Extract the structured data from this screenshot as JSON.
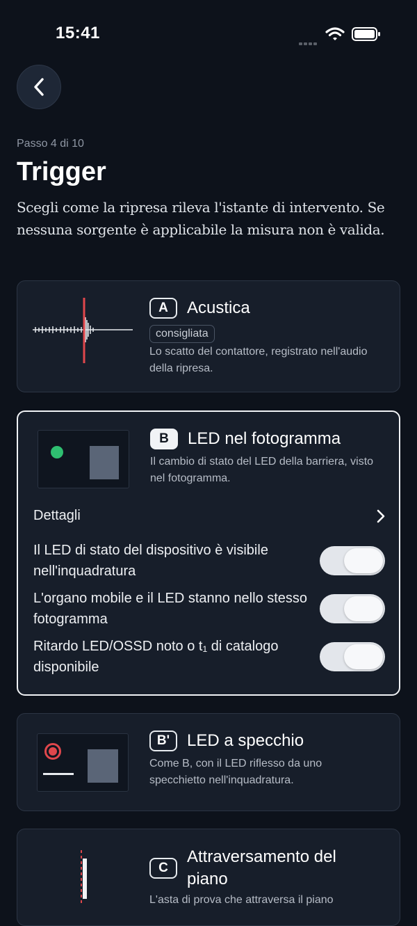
{
  "status_bar": {
    "time": "15:41"
  },
  "header": {
    "step": "Passo 4 di 10",
    "title": "Trigger",
    "subtitle": "Scegli come la ripresa rileva l'istante di intervento. Se nessuna sorgente è applicabile la misura non è valida."
  },
  "options": [
    {
      "badge": "A",
      "title": "Acustica",
      "tag": "consigliata",
      "description": "Lo scatto del contattore, registrato nell'audio della ripresa.",
      "selected": false
    },
    {
      "badge": "B",
      "title": "LED nel fotogramma",
      "description": "Il cambio di stato del LED della barriera, visto nel fotogramma.",
      "selected": true,
      "details_label": "Dettagli",
      "checks": [
        {
          "label": "Il LED di stato del dispositivo è visibile nell'inquadratura",
          "on": true
        },
        {
          "label": "L'organo mobile e il LED stanno nello stesso fotogramma",
          "on": true
        },
        {
          "label": "Ritardo LED/OSSD noto o t₁ di catalogo disponibile",
          "on": true
        }
      ]
    },
    {
      "badge": "B'",
      "title": "LED a specchio",
      "description": "Come B, con il LED riflesso da uno specchietto nell'inquadratura.",
      "selected": false
    },
    {
      "badge": "C",
      "title": "Attraversamento del piano",
      "description": "L'asta di prova che attraversa il piano",
      "selected": false
    }
  ],
  "colors": {
    "background": "#0d121b",
    "card": "#171e2a",
    "accent_red": "#e0474c",
    "led_green": "#2fbf71"
  }
}
